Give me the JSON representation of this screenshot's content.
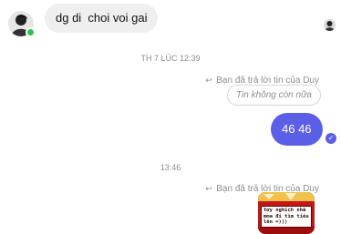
{
  "conversation": {
    "incoming_message": "dg di  choi voi gai",
    "timestamp_1": "TH 7 LÚC 12:39",
    "reply_label_1": "Bạn đã trả lời tin của Duy",
    "removed_message": "Tin không còn nữa",
    "outgoing_message": "46 46",
    "timestamp_2": "13:46",
    "reply_label_2": "Bạn đã trả lời tin của Duy",
    "sticker_text": "tơy nghich nhã mma đi tìm tiêu lên =)))"
  },
  "colors": {
    "outgoing_bubble": "#5b5fe8",
    "incoming_bubble": "#efefef",
    "online_indicator": "#31c24a",
    "meta_text": "#8a8d91"
  },
  "icons": {
    "reply": "reply-arrow-icon",
    "seen": "check-icon",
    "contact": "avatar",
    "read_receipt": "avatar-read-receipt"
  }
}
